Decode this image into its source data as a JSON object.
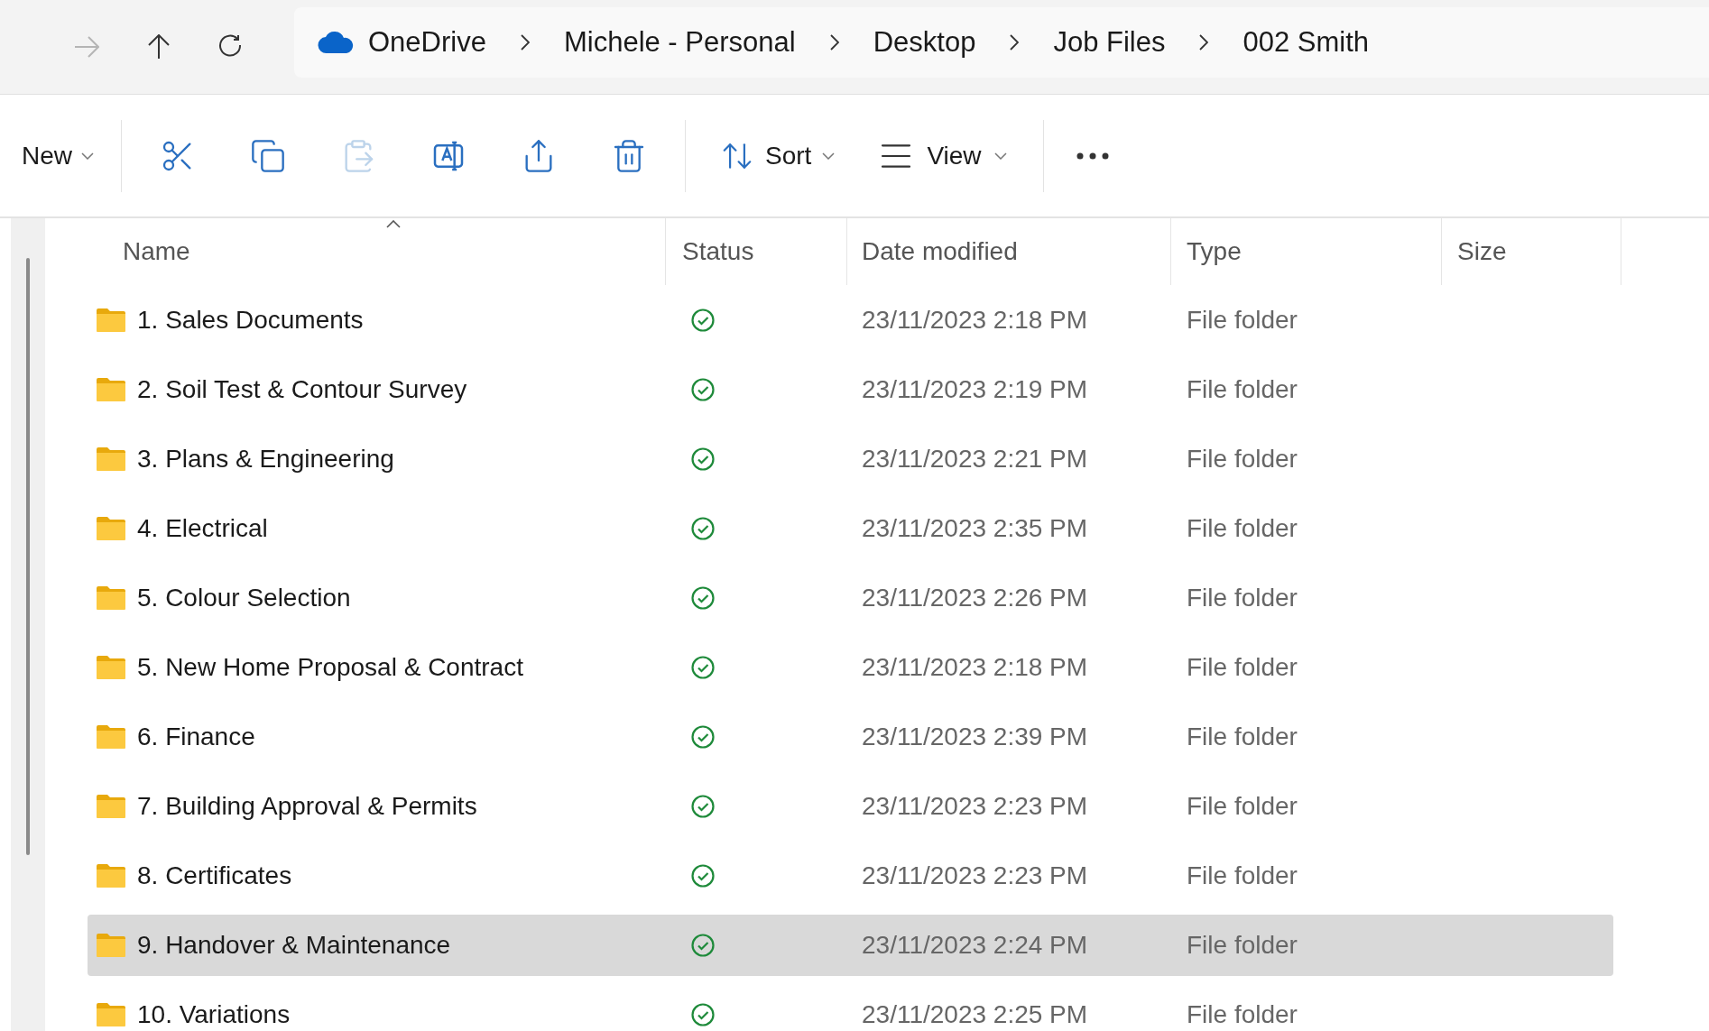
{
  "nav": {
    "buttons": [
      {
        "kind": "forward",
        "disabled": true
      },
      {
        "kind": "up",
        "disabled": false
      },
      {
        "kind": "refresh",
        "disabled": false
      }
    ]
  },
  "breadcrumb": [
    "OneDrive",
    "Michele - Personal",
    "Desktop",
    "Job Files",
    "002 Smith"
  ],
  "toolbar": {
    "new": "New",
    "actions": [
      {
        "kind": "cut",
        "disabled": false
      },
      {
        "kind": "copy",
        "disabled": false
      },
      {
        "kind": "paste",
        "disabled": true
      },
      {
        "kind": "rename",
        "disabled": false
      },
      {
        "kind": "share",
        "disabled": false
      },
      {
        "kind": "delete",
        "disabled": false
      }
    ],
    "sort": "Sort",
    "view": "View"
  },
  "table": {
    "columns": [
      {
        "label": "Name",
        "sorted": true
      },
      {
        "label": "Status",
        "sorted": false
      },
      {
        "label": "Date modified",
        "sorted": false
      },
      {
        "label": "Type",
        "sorted": false
      },
      {
        "label": "Size",
        "sorted": false
      }
    ],
    "rows": [
      {
        "name": "1. Sales Documents",
        "synced": true,
        "date": "23/11/2023 2:18 PM",
        "type": "File folder",
        "selected": false
      },
      {
        "name": "2. Soil Test & Contour Survey",
        "synced": true,
        "date": "23/11/2023 2:19 PM",
        "type": "File folder",
        "selected": false
      },
      {
        "name": "3. Plans & Engineering",
        "synced": true,
        "date": "23/11/2023 2:21 PM",
        "type": "File folder",
        "selected": false
      },
      {
        "name": "4. Electrical",
        "synced": true,
        "date": "23/11/2023 2:35 PM",
        "type": "File folder",
        "selected": false
      },
      {
        "name": "5. Colour Selection",
        "synced": true,
        "date": "23/11/2023 2:26 PM",
        "type": "File folder",
        "selected": false
      },
      {
        "name": "5. New Home Proposal & Contract",
        "synced": true,
        "date": "23/11/2023 2:18 PM",
        "type": "File folder",
        "selected": false
      },
      {
        "name": "6. Finance",
        "synced": true,
        "date": "23/11/2023 2:39 PM",
        "type": "File folder",
        "selected": false
      },
      {
        "name": "7. Building Approval & Permits",
        "synced": true,
        "date": "23/11/2023 2:23 PM",
        "type": "File folder",
        "selected": false
      },
      {
        "name": "8. Certificates",
        "synced": true,
        "date": "23/11/2023 2:23 PM",
        "type": "File folder",
        "selected": false
      },
      {
        "name": "9. Handover & Maintenance",
        "synced": true,
        "date": "23/11/2023 2:24 PM",
        "type": "File folder",
        "selected": true
      },
      {
        "name": "10. Variations",
        "synced": true,
        "date": "23/11/2023 2:25 PM",
        "type": "File folder",
        "selected": false
      }
    ]
  }
}
